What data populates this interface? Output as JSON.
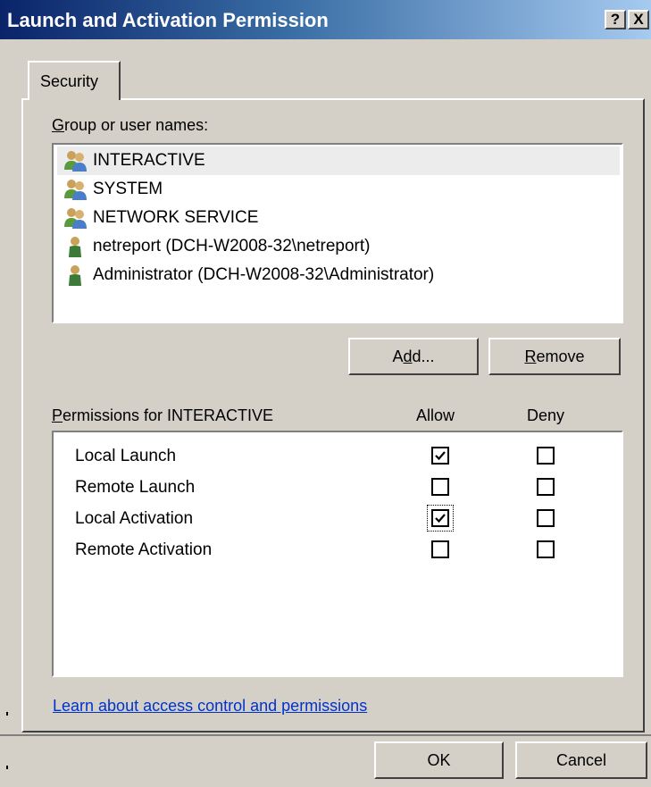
{
  "window": {
    "title": "Launch and Activation Permission",
    "help_label": "?",
    "close_label": "X"
  },
  "tabs": [
    {
      "label": "Security",
      "selected": true
    }
  ],
  "group_section": {
    "label_mnemonic": "G",
    "label_rest": "roup or user names:",
    "entries": [
      {
        "name": "INTERACTIVE",
        "icon": "group-icon",
        "selected": true
      },
      {
        "name": "SYSTEM",
        "icon": "group-icon",
        "selected": false
      },
      {
        "name": "NETWORK SERVICE",
        "icon": "group-icon",
        "selected": false
      },
      {
        "name": "netreport (DCH-W2008-32\\netreport)",
        "icon": "user-icon",
        "selected": false
      },
      {
        "name": "Administrator (DCH-W2008-32\\Administrator)",
        "icon": "user-icon",
        "selected": false
      }
    ]
  },
  "buttons": {
    "add_pre": "A",
    "add_mnemonic": "d",
    "add_post": "d...",
    "remove_mnemonic": "R",
    "remove_rest": "emove",
    "ok": "OK",
    "cancel": "Cancel"
  },
  "permissions": {
    "label_mnemonic": "P",
    "label_rest": "ermissions for INTERACTIVE",
    "allow_header": "Allow",
    "deny_header": "Deny",
    "rows": [
      {
        "name": "Local Launch",
        "allow": true,
        "deny": false
      },
      {
        "name": "Remote Launch",
        "allow": false,
        "deny": false
      },
      {
        "name": "Local Activation",
        "allow": true,
        "deny": false,
        "focused": true
      },
      {
        "name": "Remote Activation",
        "allow": false,
        "deny": false
      }
    ]
  },
  "help_link": "Learn about access control and permissions",
  "colors": {
    "title_gradient_start": "#0a246a",
    "title_gradient_end": "#a6caf0",
    "face": "#d4d0c8",
    "link": "#0033cc",
    "selection": "#ececec"
  }
}
